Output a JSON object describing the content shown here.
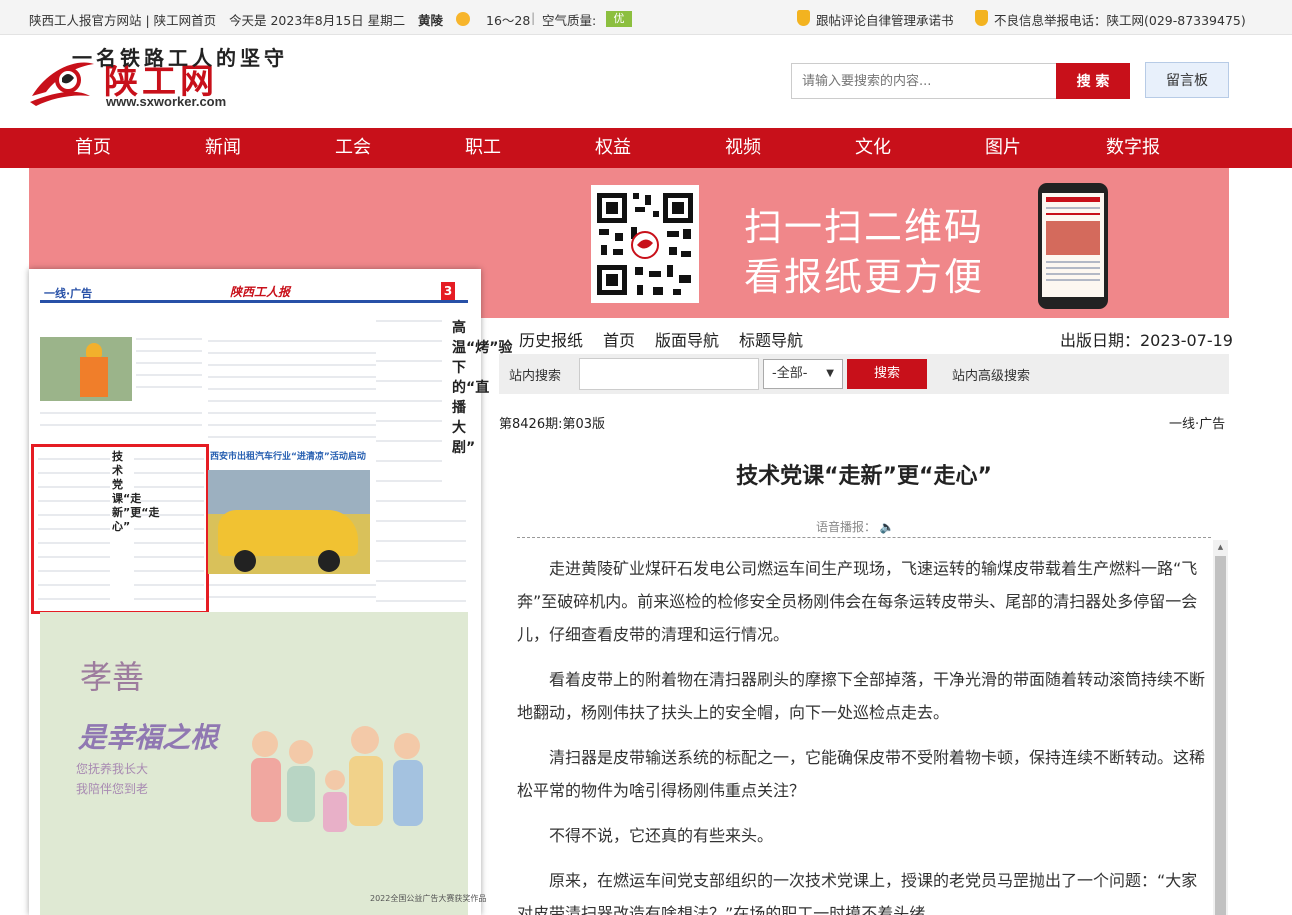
{
  "topbar": {
    "site_links": "陕西工人报官方网站 | 陕工网首页",
    "date": "今天是 2023年8月15日 星期二",
    "city": "黄陵",
    "temp": "16～28",
    "sep": "|",
    "aqi_label": "空气质量:",
    "aqi_value": "优",
    "pledge": "跟帖评论自律管理承诺书",
    "report": "不良信息举报电话：陕工网(029-87339475)"
  },
  "header": {
    "logo_text": "陕工网",
    "logo_url": "www.sxworker.com",
    "search_placeholder": "请输入要搜索的内容...",
    "search_button": "搜 索",
    "message_button": "留言板"
  },
  "nav": [
    "首页",
    "新闻",
    "工会",
    "职工",
    "权益",
    "视频",
    "文化",
    "图片",
    "数字报"
  ],
  "banner": {
    "line1": "扫一扫二维码",
    "line2": "看报纸更方便"
  },
  "paper": {
    "section": "一线·广告",
    "masthead": "陕西工人报",
    "page_no": "3",
    "headline": "一名铁路工人的坚守",
    "side_head": "高温“烤”验下的“直播大剧”",
    "rail_title": "技术党课“走新”更“走心”",
    "caption2": "西安市出租汽车行业“进清凉”活动启动",
    "ad_title": "孝善",
    "ad_sub": "是幸福之根",
    "ad_line1": "您抚养我长大",
    "ad_line2": "我陪伴您到老",
    "ad_foot": "2022全国公益广告大赛获奖作品"
  },
  "toolbar": {
    "history": "历史报纸",
    "home": "首页",
    "layout_nav": "版面导航",
    "title_nav": "标题导航",
    "pub_date": "出版日期：2023-07-19"
  },
  "site_search": {
    "label": "站内搜索",
    "select": "-全部-",
    "button": "搜索",
    "advanced": "站内高级搜索"
  },
  "article": {
    "issue": "第8426期:第03版",
    "section": "一线·广告",
    "title": "技术党课“走新”更“走心”",
    "tts": "语音播报：",
    "paragraphs": [
      "走进黄陵矿业煤矸石发电公司燃运车间生产现场，飞速运转的输煤皮带载着生产燃料一路“飞奔”至破碎机内。前来巡检的检修安全员杨刚伟会在每条运转皮带头、尾部的清扫器处多停留一会儿，仔细查看皮带的清理和运行情况。",
      "看着皮带上的附着物在清扫器刷头的摩擦下全部掉落，干净光滑的带面随着转动滚筒持续不断地翻动，杨刚伟扶了扶头上的安全帽，向下一处巡检点走去。",
      "清扫器是皮带输送系统的标配之一，它能确保皮带不受附着物卡顿，保持连续不断转动。这稀松平常的物件为啥引得杨刚伟重点关注？",
      "不得不说，它还真的有些来头。",
      "原来，在燃运车间党支部组织的一次技术党课上，授课的老党员马罡抛出了一个问题：“大家对皮带清扫器改造有啥想法？”在场的职工一时摸不着头绪。"
    ]
  },
  "colors": {
    "brand_red": "#c8101a",
    "banner_pink": "#f0878a",
    "highlight_red": "#e51c23"
  }
}
